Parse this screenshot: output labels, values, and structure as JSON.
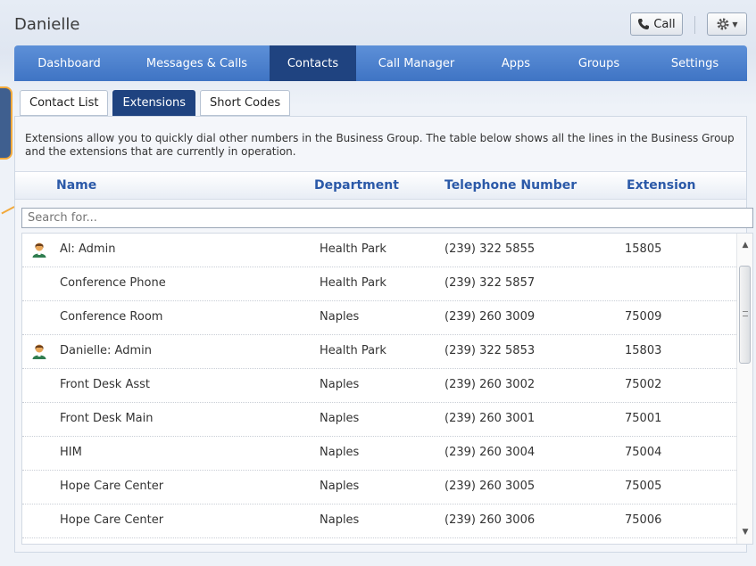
{
  "window": {
    "title": "Danielle"
  },
  "toolbar": {
    "call_label": "Call"
  },
  "nav": {
    "items": [
      {
        "label": "Dashboard",
        "active": false
      },
      {
        "label": "Messages & Calls",
        "active": false
      },
      {
        "label": "Contacts",
        "active": true
      },
      {
        "label": "Call Manager",
        "active": false
      },
      {
        "label": "Apps",
        "active": false
      },
      {
        "label": "Groups",
        "active": false
      },
      {
        "label": "Settings",
        "active": false
      }
    ]
  },
  "subtabs": [
    {
      "label": "Contact List",
      "active": false
    },
    {
      "label": "Extensions",
      "active": true
    },
    {
      "label": "Short Codes",
      "active": false
    }
  ],
  "description": "Extensions allow you to quickly dial other numbers in the Business Group. The table below shows all the lines in the Business Group and the extensions that are currently in operation.",
  "table": {
    "headers": [
      "Name",
      "Department",
      "Telephone Number",
      "Extension"
    ],
    "search_placeholder": "Search for...",
    "rows": [
      {
        "name": "Al: Admin",
        "department": "Health Park",
        "phone": "(239) 322 5855",
        "extension": "15805",
        "avatar": true
      },
      {
        "name": "Conference Phone",
        "department": "Health Park",
        "phone": "(239) 322 5857",
        "extension": "",
        "avatar": false
      },
      {
        "name": "Conference Room",
        "department": "Naples",
        "phone": "(239) 260 3009",
        "extension": "75009",
        "avatar": false
      },
      {
        "name": "Danielle: Admin",
        "department": "Health Park",
        "phone": "(239) 322 5853",
        "extension": "15803",
        "avatar": true
      },
      {
        "name": "Front Desk Asst",
        "department": "Naples",
        "phone": "(239) 260 3002",
        "extension": "75002",
        "avatar": false
      },
      {
        "name": "Front Desk Main",
        "department": "Naples",
        "phone": "(239) 260 3001",
        "extension": "75001",
        "avatar": false
      },
      {
        "name": "HIM",
        "department": "Naples",
        "phone": "(239) 260 3004",
        "extension": "75004",
        "avatar": false
      },
      {
        "name": "Hope Care Center",
        "department": "Naples",
        "phone": "(239) 260 3005",
        "extension": "75005",
        "avatar": false
      },
      {
        "name": "Hope Care Center",
        "department": "Naples",
        "phone": "(239) 260 3006",
        "extension": "75006",
        "avatar": false
      }
    ]
  },
  "colors": {
    "nav_bg": "#4a80cc",
    "nav_active": "#1f4380",
    "header_text": "#2b59a8",
    "callout_border": "#f2a93b"
  }
}
